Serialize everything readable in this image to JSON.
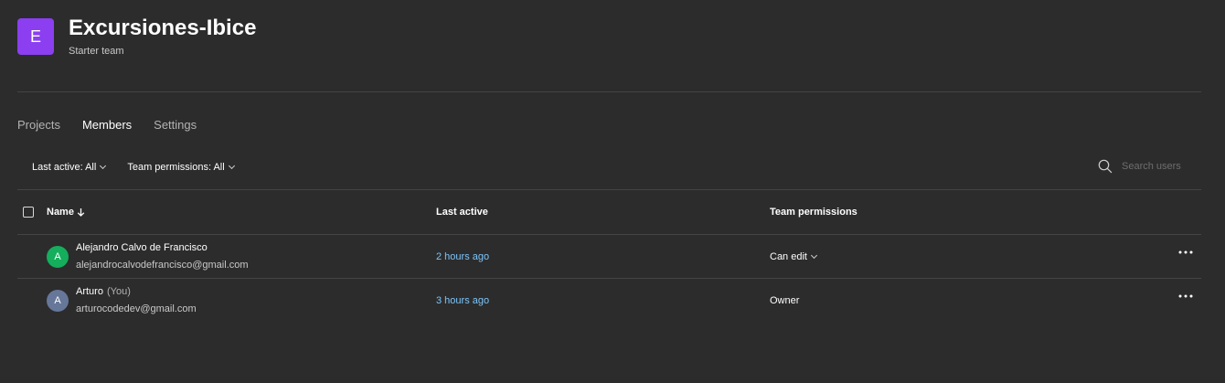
{
  "team": {
    "logo_letter": "E",
    "name": "Excursiones-Ibice",
    "plan": "Starter team",
    "logo_color": "#8b3ff0"
  },
  "tabs": [
    {
      "label": "Projects",
      "active": false
    },
    {
      "label": "Members",
      "active": true
    },
    {
      "label": "Settings",
      "active": false
    }
  ],
  "filters": {
    "last_active": "Last active: All",
    "permissions": "Team permissions: All"
  },
  "search": {
    "placeholder": "Search users",
    "icon": "search-icon"
  },
  "table": {
    "headers": {
      "name": "Name",
      "last_active": "Last active",
      "permissions": "Team permissions"
    },
    "sort_icon": "arrow-down-icon"
  },
  "members": [
    {
      "initial": "A",
      "name": "Alejandro Calvo de Francisco",
      "you": "",
      "email": "alejandrocalvodefrancisco@gmail.com",
      "last_active": "2 hours ago",
      "permission": "Can edit",
      "avatar_color": "#14ae5c"
    },
    {
      "initial": "A",
      "name": "Arturo",
      "you": "(You)",
      "email": "arturocodedev@gmail.com",
      "last_active": "3 hours ago",
      "permission": "Owner",
      "avatar_color": "#667799"
    }
  ],
  "colors": {
    "background": "#2c2c2c",
    "link": "#7cc4f8",
    "divider": "#444444"
  }
}
